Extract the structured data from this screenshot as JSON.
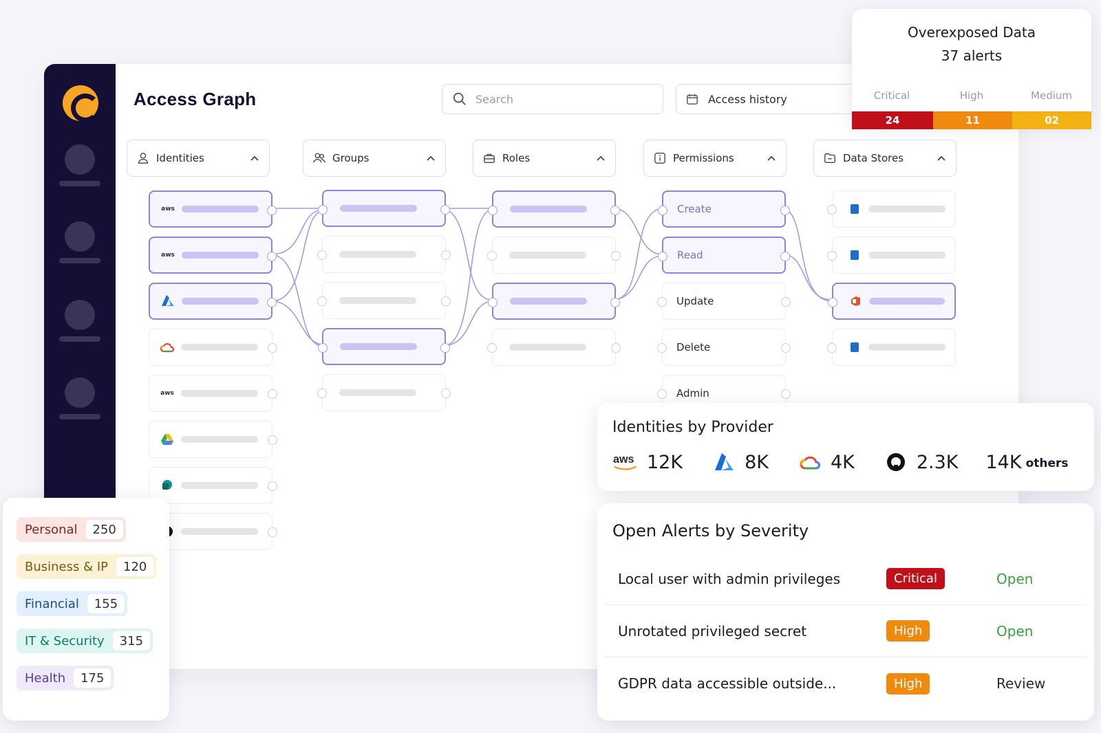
{
  "header": {
    "title": "Access Graph",
    "search_placeholder": "Search",
    "history_label": "Access history"
  },
  "columns": [
    "Identities",
    "Groups",
    "Roles",
    "Permissions",
    "Data Stores"
  ],
  "permissions": [
    "Create",
    "Read",
    "Update",
    "Delete",
    "Admin"
  ],
  "identity_logos": [
    "aws",
    "aws",
    "azure",
    "gcp",
    "aws",
    "gdrive",
    "sharepoint",
    "github"
  ],
  "overexposed": {
    "title": "Overexposed Data",
    "subtitle": "37 alerts",
    "levels": [
      {
        "label": "Critical",
        "value": "24",
        "color": "#c0111a"
      },
      {
        "label": "High",
        "value": "11",
        "color": "#f08a0f"
      },
      {
        "label": "Medium",
        "value": "02",
        "color": "#f2b213"
      }
    ]
  },
  "providers": {
    "title": "Identities by Provider",
    "items": [
      {
        "icon": "aws-icon",
        "value": "12K"
      },
      {
        "icon": "azure-icon",
        "value": "8K"
      },
      {
        "icon": "google-cloud-icon",
        "value": "4K"
      },
      {
        "icon": "github-icon",
        "value": "2.3K"
      },
      {
        "icon": "",
        "value": "14K",
        "suffix": "others"
      }
    ]
  },
  "alerts": {
    "title": "Open Alerts by Severity",
    "rows": [
      {
        "name": "Local user with admin privileges",
        "severity": "Critical",
        "sev_color": "#c0111a",
        "status": "Open",
        "status_color": "#3ba13e"
      },
      {
        "name": "Unrotated privileged secret",
        "severity": "High",
        "sev_color": "#f08a0f",
        "status": "Open",
        "status_color": "#3ba13e"
      },
      {
        "name": "GDPR data accessible outside...",
        "severity": "High",
        "sev_color": "#f08a0f",
        "status": "Review",
        "status_color": "#2b2940"
      }
    ]
  },
  "categories": [
    {
      "name": "Personal",
      "value": "250",
      "bg": "#fbe5e3",
      "fg": "#7a2a22"
    },
    {
      "name": "Business & IP",
      "value": "120",
      "bg": "#fbf1d4",
      "fg": "#7a5a12"
    },
    {
      "name": "Financial",
      "value": "155",
      "bg": "#e2effd",
      "fg": "#1e4d86"
    },
    {
      "name": "IT & Security",
      "value": "315",
      "bg": "#dcf5ef",
      "fg": "#16766a"
    },
    {
      "name": "Health",
      "value": "175",
      "bg": "#efe9fb",
      "fg": "#5a3f94"
    }
  ]
}
